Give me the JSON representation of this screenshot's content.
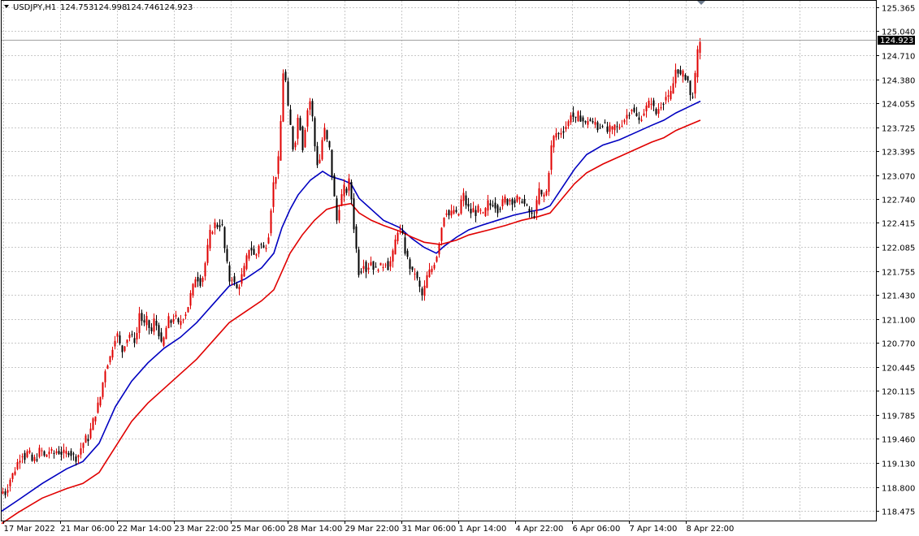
{
  "header": {
    "menu_icon": "triangle-down-icon",
    "symbol": "USDJPY,H1",
    "open": "124.753",
    "high": "124.998",
    "low": "124.746",
    "close": "124.923"
  },
  "current_price_label": "124.923",
  "colors": {
    "bull": "#e00000",
    "bear": "#000000",
    "ma_fast": "#0000c0",
    "ma_slow": "#e00000",
    "grid": "#c8c8c8",
    "price_tag_bg": "#000000"
  },
  "chart_data": {
    "type": "candlestick",
    "symbol": "USDJPY",
    "timeframe": "H1",
    "ylim": [
      118.32,
      125.44
    ],
    "y_ticks": [
      "125.365",
      "125.040",
      "124.710",
      "124.380",
      "124.055",
      "123.725",
      "123.395",
      "123.070",
      "122.740",
      "122.415",
      "122.085",
      "121.755",
      "121.430",
      "121.100",
      "120.770",
      "120.445",
      "120.115",
      "119.785",
      "119.460",
      "119.130",
      "118.800",
      "118.475"
    ],
    "x_ticks": [
      "17 Mar 2022",
      "21 Mar 06:00",
      "22 Mar 14:00",
      "23 Mar 22:00",
      "25 Mar 06:00",
      "28 Mar 14:00",
      "29 Mar 22:00",
      "31 Mar 06:00",
      "1 Apr 14:00",
      "4 Apr 22:00",
      "6 Apr 06:00",
      "7 Apr 14:00",
      "8 Apr 22:00"
    ],
    "grid": true,
    "last_price": 124.923,
    "price_path": [
      [
        0,
        118.75
      ],
      [
        5,
        118.72
      ],
      [
        10,
        118.9
      ],
      [
        15,
        119.0
      ],
      [
        20,
        119.15
      ],
      [
        25,
        119.28
      ],
      [
        28,
        119.2
      ],
      [
        33,
        119.3
      ],
      [
        37,
        119.15
      ],
      [
        43,
        119.2
      ],
      [
        48,
        119.33
      ],
      [
        53,
        119.2
      ],
      [
        58,
        119.3
      ],
      [
        63,
        119.25
      ],
      [
        68,
        119.3
      ],
      [
        73,
        119.27
      ],
      [
        78,
        119.25
      ],
      [
        83,
        119.3
      ],
      [
        88,
        119.22
      ],
      [
        93,
        119.2
      ],
      [
        98,
        119.35
      ],
      [
        103,
        119.46
      ],
      [
        106,
        119.45
      ],
      [
        110,
        119.6
      ],
      [
        115,
        119.8
      ],
      [
        118,
        119.9
      ],
      [
        121,
        120.0
      ],
      [
        124,
        120.2
      ],
      [
        127,
        120.4
      ],
      [
        130,
        120.5
      ],
      [
        133,
        120.55
      ],
      [
        136,
        120.7
      ],
      [
        139,
        120.85
      ],
      [
        142,
        120.9
      ],
      [
        145,
        120.75
      ],
      [
        149,
        120.65
      ],
      [
        152,
        120.8
      ],
      [
        155,
        120.85
      ],
      [
        158,
        120.9
      ],
      [
        162,
        120.8
      ],
      [
        166,
        120.85
      ],
      [
        169,
        121.2
      ],
      [
        172,
        121.1
      ],
      [
        175,
        121.0
      ],
      [
        178,
        121.1
      ],
      [
        181,
        121.0
      ],
      [
        184,
        120.9
      ],
      [
        188,
        121.1
      ],
      [
        191,
        121.0
      ],
      [
        194,
        120.9
      ],
      [
        197,
        120.7
      ],
      [
        200,
        120.85
      ],
      [
        203,
        121.0
      ],
      [
        206,
        121.1
      ],
      [
        209,
        121.05
      ],
      [
        212,
        121.15
      ],
      [
        215,
        121.1
      ],
      [
        218,
        121.0
      ],
      [
        221,
        121.1
      ],
      [
        224,
        121.15
      ],
      [
        227,
        121.2
      ],
      [
        230,
        121.3
      ],
      [
        233,
        121.45
      ],
      [
        236,
        121.55
      ],
      [
        239,
        121.7
      ],
      [
        242,
        121.65
      ],
      [
        245,
        121.6
      ],
      [
        248,
        121.7
      ],
      [
        251,
        121.9
      ],
      [
        254,
        122.1
      ],
      [
        257,
        122.3
      ],
      [
        260,
        122.35
      ],
      [
        263,
        122.4
      ],
      [
        266,
        122.38
      ],
      [
        269,
        122.4
      ],
      [
        272,
        122.35
      ],
      [
        275,
        122.0
      ],
      [
        278,
        121.8
      ],
      [
        281,
        121.6
      ],
      [
        284,
        121.7
      ],
      [
        287,
        121.55
      ],
      [
        290,
        121.5
      ],
      [
        293,
        121.6
      ],
      [
        296,
        121.7
      ],
      [
        299,
        121.8
      ],
      [
        302,
        121.95
      ],
      [
        305,
        122.1
      ],
      [
        308,
        122.05
      ],
      [
        311,
        121.95
      ],
      [
        314,
        122.0
      ],
      [
        317,
        122.15
      ],
      [
        320,
        122.1
      ],
      [
        323,
        122.05
      ],
      [
        326,
        122.15
      ],
      [
        329,
        122.3
      ],
      [
        332,
        122.7
      ],
      [
        335,
        123.0
      ],
      [
        338,
        123.1
      ],
      [
        341,
        123.3
      ],
      [
        344,
        123.9
      ],
      [
        347,
        124.6
      ],
      [
        350,
        124.3
      ],
      [
        353,
        123.9
      ],
      [
        356,
        123.7
      ],
      [
        359,
        123.4
      ],
      [
        362,
        123.6
      ],
      [
        365,
        123.9
      ],
      [
        368,
        123.7
      ],
      [
        371,
        123.4
      ],
      [
        374,
        123.8
      ],
      [
        377,
        124.0
      ],
      [
        380,
        124.1
      ],
      [
        383,
        123.8
      ],
      [
        386,
        123.4
      ],
      [
        389,
        123.2
      ],
      [
        392,
        123.3
      ],
      [
        395,
        123.6
      ],
      [
        398,
        123.7
      ],
      [
        401,
        123.5
      ],
      [
        404,
        123.4
      ],
      [
        407,
        123.0
      ],
      [
        410,
        122.7
      ],
      [
        413,
        122.4
      ],
      [
        416,
        122.7
      ],
      [
        419,
        122.8
      ],
      [
        422,
        122.9
      ],
      [
        425,
        122.85
      ],
      [
        428,
        123.0
      ],
      [
        431,
        122.7
      ],
      [
        434,
        122.3
      ],
      [
        437,
        122.0
      ],
      [
        440,
        121.7
      ],
      [
        443,
        121.8
      ],
      [
        446,
        121.9
      ],
      [
        449,
        121.75
      ],
      [
        452,
        121.85
      ],
      [
        455,
        121.9
      ],
      [
        458,
        121.8
      ],
      [
        461,
        121.75
      ],
      [
        464,
        121.85
      ],
      [
        467,
        121.8
      ],
      [
        470,
        121.85
      ],
      [
        473,
        121.9
      ],
      [
        476,
        121.8
      ],
      [
        479,
        121.9
      ],
      [
        482,
        122.0
      ],
      [
        485,
        122.2
      ],
      [
        488,
        122.35
      ],
      [
        491,
        122.3
      ],
      [
        494,
        122.2
      ],
      [
        497,
        122.0
      ],
      [
        500,
        121.9
      ],
      [
        503,
        121.8
      ],
      [
        506,
        121.7
      ],
      [
        509,
        121.75
      ],
      [
        512,
        121.6
      ],
      [
        515,
        121.5
      ],
      [
        518,
        121.4
      ],
      [
        521,
        121.55
      ],
      [
        524,
        121.7
      ],
      [
        527,
        121.75
      ],
      [
        530,
        121.8
      ],
      [
        533,
        121.9
      ],
      [
        536,
        122.0
      ],
      [
        539,
        122.2
      ],
      [
        542,
        122.4
      ],
      [
        545,
        122.55
      ],
      [
        548,
        122.6
      ],
      [
        551,
        122.5
      ],
      [
        554,
        122.55
      ],
      [
        557,
        122.6
      ],
      [
        560,
        122.5
      ],
      [
        563,
        122.55
      ],
      [
        566,
        122.75
      ],
      [
        569,
        122.8
      ],
      [
        572,
        122.65
      ],
      [
        575,
        122.6
      ],
      [
        578,
        122.55
      ],
      [
        581,
        122.6
      ],
      [
        584,
        122.55
      ],
      [
        587,
        122.6
      ],
      [
        590,
        122.55
      ],
      [
        593,
        122.5
      ],
      [
        596,
        122.6
      ],
      [
        599,
        122.7
      ],
      [
        602,
        122.65
      ],
      [
        605,
        122.7
      ],
      [
        608,
        122.65
      ],
      [
        611,
        122.6
      ],
      [
        614,
        122.65
      ],
      [
        617,
        122.7
      ],
      [
        620,
        122.75
      ],
      [
        623,
        122.7
      ],
      [
        626,
        122.75
      ],
      [
        629,
        122.72
      ],
      [
        632,
        122.7
      ],
      [
        635,
        122.75
      ],
      [
        638,
        122.7
      ],
      [
        641,
        122.75
      ],
      [
        644,
        122.65
      ],
      [
        647,
        122.6
      ],
      [
        650,
        122.55
      ],
      [
        653,
        122.5
      ],
      [
        656,
        122.55
      ],
      [
        659,
        122.7
      ],
      [
        662,
        122.9
      ],
      [
        665,
        122.75
      ],
      [
        668,
        122.8
      ],
      [
        671,
        122.85
      ],
      [
        674,
        123.2
      ],
      [
        677,
        123.5
      ],
      [
        680,
        123.6
      ],
      [
        683,
        123.65
      ],
      [
        686,
        123.62
      ],
      [
        689,
        123.68
      ],
      [
        692,
        123.7
      ],
      [
        695,
        123.75
      ],
      [
        698,
        123.8
      ],
      [
        701,
        123.95
      ],
      [
        704,
        123.85
      ],
      [
        707,
        123.8
      ],
      [
        710,
        123.9
      ],
      [
        713,
        123.85
      ],
      [
        716,
        123.8
      ],
      [
        719,
        123.75
      ],
      [
        722,
        123.85
      ],
      [
        725,
        123.8
      ],
      [
        728,
        123.75
      ],
      [
        731,
        123.8
      ],
      [
        734,
        123.7
      ],
      [
        737,
        123.75
      ],
      [
        740,
        123.8
      ],
      [
        743,
        123.72
      ],
      [
        746,
        123.65
      ],
      [
        749,
        123.7
      ],
      [
        752,
        123.68
      ],
      [
        755,
        123.75
      ],
      [
        758,
        123.7
      ],
      [
        761,
        123.75
      ],
      [
        764,
        123.8
      ],
      [
        767,
        123.85
      ],
      [
        770,
        123.9
      ],
      [
        773,
        123.95
      ],
      [
        776,
        124.0
      ],
      [
        779,
        123.9
      ],
      [
        782,
        123.85
      ],
      [
        785,
        123.8
      ],
      [
        788,
        123.9
      ],
      [
        791,
        123.95
      ],
      [
        794,
        124.0
      ],
      [
        797,
        124.05
      ],
      [
        800,
        124.1
      ],
      [
        803,
        123.95
      ],
      [
        806,
        123.9
      ],
      [
        809,
        124.0
      ],
      [
        812,
        124.05
      ],
      [
        815,
        124.1
      ],
      [
        818,
        124.15
      ],
      [
        821,
        124.1
      ],
      [
        824,
        124.2
      ],
      [
        827,
        124.35
      ],
      [
        830,
        124.55
      ],
      [
        833,
        124.5
      ],
      [
        836,
        124.4
      ],
      [
        839,
        124.45
      ],
      [
        842,
        124.42
      ],
      [
        845,
        124.35
      ],
      [
        848,
        124.1
      ],
      [
        851,
        124.2
      ],
      [
        854,
        124.45
      ],
      [
        857,
        124.8
      ],
      [
        859,
        124.92
      ]
    ],
    "moving_averages": [
      {
        "color": "blue",
        "points": [
          [
            0,
            118.47
          ],
          [
            20,
            118.62
          ],
          [
            50,
            118.85
          ],
          [
            80,
            119.05
          ],
          [
            100,
            119.15
          ],
          [
            120,
            119.4
          ],
          [
            140,
            119.9
          ],
          [
            160,
            120.25
          ],
          [
            180,
            120.5
          ],
          [
            200,
            120.7
          ],
          [
            220,
            120.85
          ],
          [
            240,
            121.05
          ],
          [
            260,
            121.3
          ],
          [
            280,
            121.55
          ],
          [
            300,
            121.65
          ],
          [
            320,
            121.8
          ],
          [
            335,
            122.0
          ],
          [
            345,
            122.35
          ],
          [
            355,
            122.6
          ],
          [
            365,
            122.8
          ],
          [
            380,
            123.0
          ],
          [
            395,
            123.12
          ],
          [
            405,
            123.05
          ],
          [
            420,
            123.0
          ],
          [
            430,
            122.95
          ],
          [
            440,
            122.75
          ],
          [
            455,
            122.6
          ],
          [
            470,
            122.45
          ],
          [
            490,
            122.35
          ],
          [
            505,
            122.2
          ],
          [
            520,
            122.08
          ],
          [
            535,
            122.0
          ],
          [
            545,
            122.1
          ],
          [
            560,
            122.22
          ],
          [
            575,
            122.32
          ],
          [
            590,
            122.38
          ],
          [
            610,
            122.45
          ],
          [
            630,
            122.52
          ],
          [
            650,
            122.57
          ],
          [
            665,
            122.6
          ],
          [
            675,
            122.65
          ],
          [
            690,
            122.9
          ],
          [
            705,
            123.15
          ],
          [
            720,
            123.35
          ],
          [
            740,
            123.48
          ],
          [
            760,
            123.55
          ],
          [
            780,
            123.65
          ],
          [
            800,
            123.75
          ],
          [
            815,
            123.82
          ],
          [
            830,
            123.92
          ],
          [
            845,
            124.0
          ],
          [
            860,
            124.08
          ]
        ]
      },
      {
        "color": "red",
        "points": [
          [
            0,
            118.3
          ],
          [
            20,
            118.45
          ],
          [
            50,
            118.65
          ],
          [
            80,
            118.78
          ],
          [
            100,
            118.85
          ],
          [
            120,
            119.0
          ],
          [
            140,
            119.35
          ],
          [
            160,
            119.7
          ],
          [
            180,
            119.95
          ],
          [
            200,
            120.15
          ],
          [
            220,
            120.35
          ],
          [
            240,
            120.55
          ],
          [
            260,
            120.8
          ],
          [
            280,
            121.05
          ],
          [
            300,
            121.2
          ],
          [
            320,
            121.35
          ],
          [
            335,
            121.5
          ],
          [
            345,
            121.75
          ],
          [
            355,
            122.0
          ],
          [
            370,
            122.25
          ],
          [
            385,
            122.45
          ],
          [
            400,
            122.6
          ],
          [
            415,
            122.65
          ],
          [
            430,
            122.68
          ],
          [
            440,
            122.55
          ],
          [
            455,
            122.45
          ],
          [
            470,
            122.38
          ],
          [
            490,
            122.3
          ],
          [
            505,
            122.22
          ],
          [
            520,
            122.15
          ],
          [
            540,
            122.12
          ],
          [
            560,
            122.18
          ],
          [
            575,
            122.25
          ],
          [
            600,
            122.32
          ],
          [
            620,
            122.38
          ],
          [
            640,
            122.45
          ],
          [
            660,
            122.5
          ],
          [
            675,
            122.55
          ],
          [
            690,
            122.75
          ],
          [
            705,
            122.95
          ],
          [
            720,
            123.1
          ],
          [
            740,
            123.22
          ],
          [
            760,
            123.32
          ],
          [
            780,
            123.42
          ],
          [
            800,
            123.52
          ],
          [
            815,
            123.58
          ],
          [
            830,
            123.68
          ],
          [
            845,
            123.75
          ],
          [
            860,
            123.82
          ]
        ]
      }
    ]
  }
}
